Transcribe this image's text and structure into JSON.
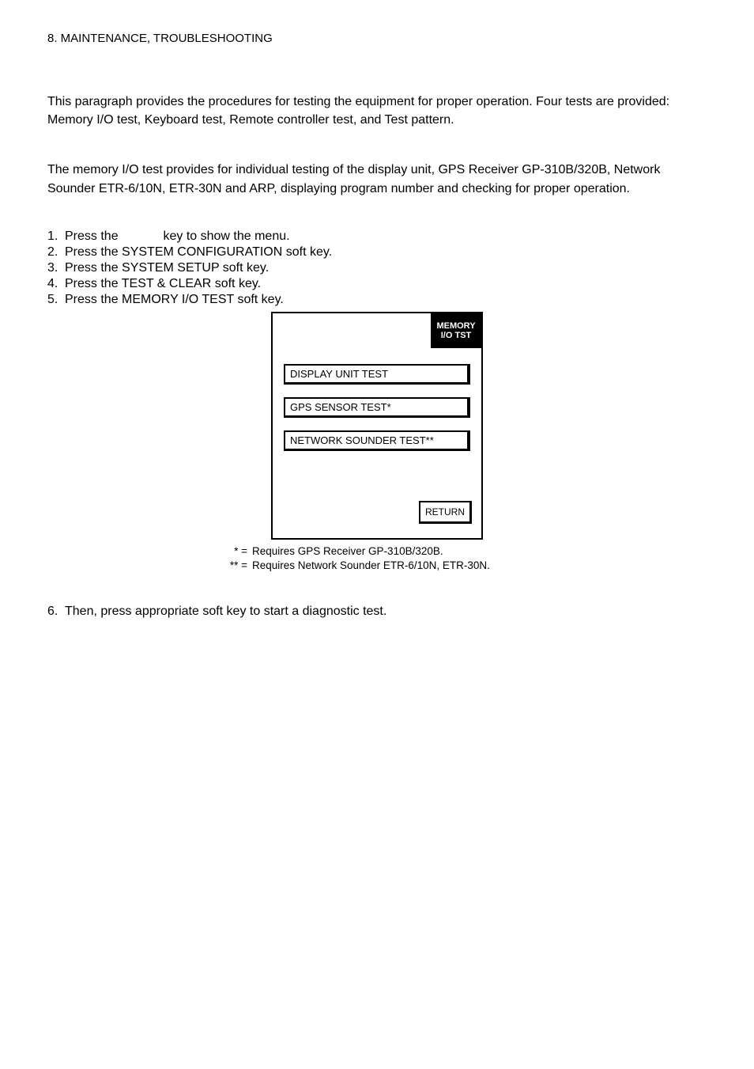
{
  "header": "8. MAINTENANCE, TROUBLESHOOTING",
  "intro": "This paragraph provides the procedures for testing the equipment for proper operation. Four tests are provided: Memory I/O test, Keyboard test, Remote controller test, and Test pattern.",
  "memio_para": "The memory I/O test provides for individual testing of the display unit, GPS Receiver GP-310B/320B, Network Sounder ETR-6/10N, ETR-30N and ARP, displaying program number and checking for proper operation.",
  "steps": [
    {
      "num": "1.",
      "pre": "Press the ",
      "mid": "",
      "post": " key to show the menu."
    },
    {
      "num": "2.",
      "pre": "Press the SYSTEM CONFIGURATION soft key.",
      "mid": "",
      "post": ""
    },
    {
      "num": "3.",
      "pre": "Press the SYSTEM SETUP soft key.",
      "mid": "",
      "post": ""
    },
    {
      "num": "4.",
      "pre": "Press the TEST & CLEAR soft key.",
      "mid": "",
      "post": ""
    },
    {
      "num": "5.",
      "pre": "Press the MEMORY I/O TEST soft key.",
      "mid": "",
      "post": ""
    }
  ],
  "device": {
    "title_line1": "MEMORY",
    "title_line2": "I/O TST",
    "softkeys": [
      "DISPLAY UNIT TEST",
      "GPS SENSOR TEST*",
      "NETWORK SOUNDER TEST**"
    ],
    "return": "RETURN"
  },
  "footnotes": [
    {
      "sym": "*  =",
      "text": "Requires GPS Receiver GP-310B/320B."
    },
    {
      "sym": "** =",
      "text": "Requires Network Sounder ETR-6/10N, ETR-30N."
    }
  ],
  "closing": {
    "num": "6.",
    "text": "Then, press appropriate soft key to start a diagnostic test."
  }
}
